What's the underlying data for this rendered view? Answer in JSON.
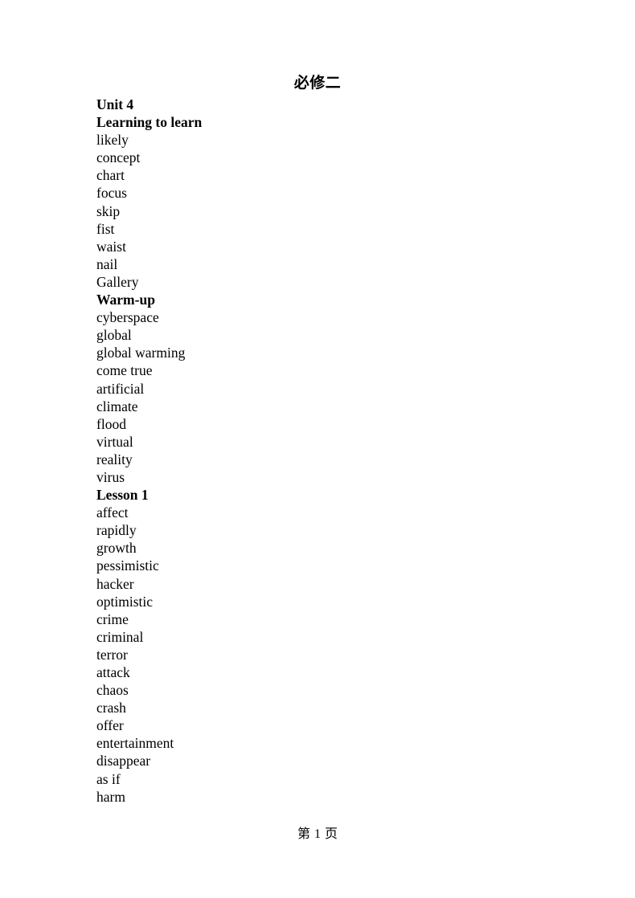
{
  "document": {
    "title": "必修二",
    "footer": {
      "prefix": "第",
      "page_number": "1",
      "suffix": "页"
    },
    "lines": [
      {
        "text": "Unit 4",
        "bold": true
      },
      {
        "text": "Learning to learn",
        "bold": true
      },
      {
        "text": "likely",
        "bold": false
      },
      {
        "text": "concept",
        "bold": false
      },
      {
        "text": "chart",
        "bold": false
      },
      {
        "text": "focus",
        "bold": false
      },
      {
        "text": "skip",
        "bold": false
      },
      {
        "text": "fist",
        "bold": false
      },
      {
        "text": "waist",
        "bold": false
      },
      {
        "text": "nail",
        "bold": false
      },
      {
        "text": "Gallery",
        "bold": false
      },
      {
        "text": "Warm-up",
        "bold": true
      },
      {
        "text": "cyberspace",
        "bold": false
      },
      {
        "text": "global",
        "bold": false
      },
      {
        "text": "global warming",
        "bold": false
      },
      {
        "text": "come true",
        "bold": false
      },
      {
        "text": "artificial",
        "bold": false
      },
      {
        "text": "climate",
        "bold": false
      },
      {
        "text": "flood",
        "bold": false
      },
      {
        "text": "virtual",
        "bold": false
      },
      {
        "text": "reality",
        "bold": false
      },
      {
        "text": "virus",
        "bold": false
      },
      {
        "text": "Lesson 1",
        "bold": true
      },
      {
        "text": "affect",
        "bold": false
      },
      {
        "text": "rapidly",
        "bold": false
      },
      {
        "text": "growth",
        "bold": false
      },
      {
        "text": "pessimistic",
        "bold": false
      },
      {
        "text": "hacker",
        "bold": false
      },
      {
        "text": "optimistic",
        "bold": false
      },
      {
        "text": "crime",
        "bold": false
      },
      {
        "text": "criminal",
        "bold": false
      },
      {
        "text": "terror",
        "bold": false
      },
      {
        "text": "attack",
        "bold": false
      },
      {
        "text": "chaos",
        "bold": false
      },
      {
        "text": "crash",
        "bold": false
      },
      {
        "text": "offer",
        "bold": false
      },
      {
        "text": "entertainment",
        "bold": false
      },
      {
        "text": "disappear",
        "bold": false
      },
      {
        "text": "as if",
        "bold": false
      },
      {
        "text": "harm",
        "bold": false
      }
    ]
  }
}
